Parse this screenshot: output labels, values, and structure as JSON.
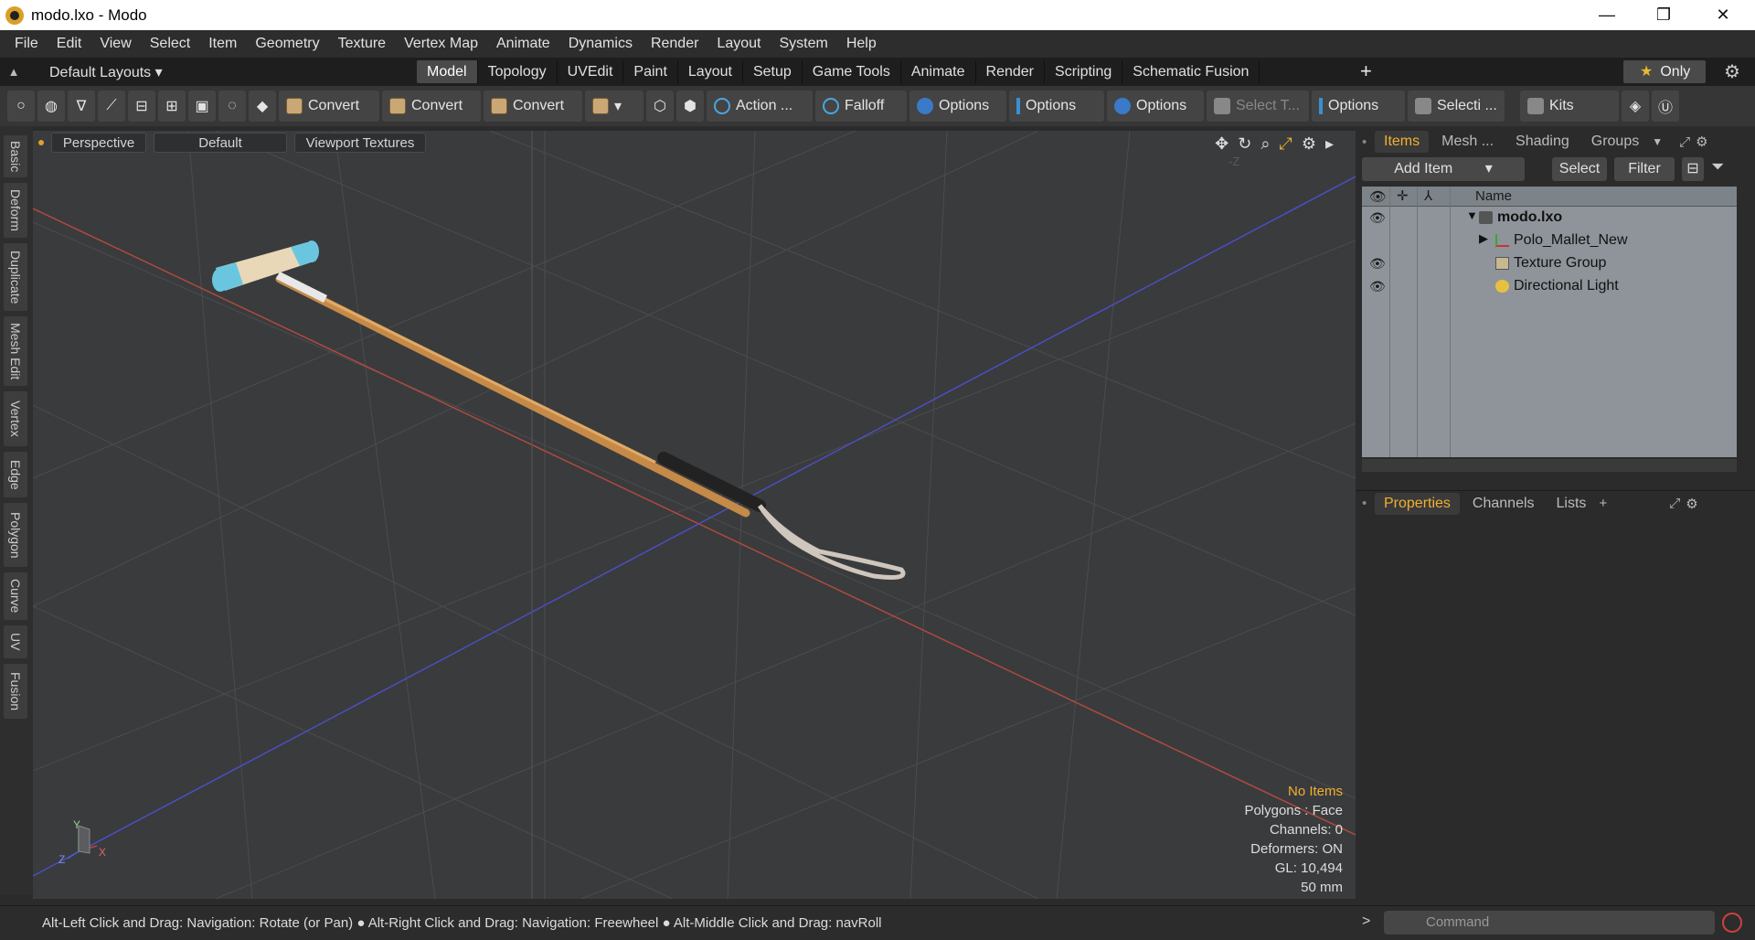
{
  "window": {
    "title": "modo.lxo - Modo",
    "minimize": "—",
    "restore": "❐",
    "close": "✕"
  },
  "menu": [
    "File",
    "Edit",
    "View",
    "Select",
    "Item",
    "Geometry",
    "Texture",
    "Vertex Map",
    "Animate",
    "Dynamics",
    "Render",
    "Layout",
    "System",
    "Help"
  ],
  "layouts": {
    "preset": "Default Layouts ▾",
    "tabs": [
      "Model",
      "Topology",
      "UVEdit",
      "Paint",
      "Layout",
      "Setup",
      "Game Tools",
      "Animate",
      "Render",
      "Scripting",
      "Schematic Fusion"
    ],
    "active_tab": "Model",
    "only": "Only"
  },
  "toolbar": {
    "convert1": "Convert",
    "convert2": "Convert",
    "convert3": "Convert",
    "action": "Action   ...",
    "falloff": "Falloff",
    "options1": "Options",
    "options2": "Options",
    "options3": "Options",
    "select_t": "Select T...",
    "options4": "Options",
    "selecti": "Selecti ...",
    "kits": "Kits"
  },
  "left_tabs": [
    "Basic",
    "Deform",
    "Duplicate",
    "Mesh Edit",
    "Vertex",
    "Edge",
    "Polygon",
    "Curve",
    "UV",
    "Fusion"
  ],
  "viewport": {
    "view": "Perspective",
    "shading": "Default",
    "textures": "Viewport Textures",
    "axis_label": "-Z",
    "info": {
      "no_items": "No Items",
      "polygons": "Polygons : Face",
      "channels": "Channels: 0",
      "deformers": "Deformers: ON",
      "gl": "GL: 10,494",
      "scale": "50 mm"
    },
    "gizmo": {
      "x": "X",
      "y": "Y",
      "z": "Z"
    }
  },
  "items_panel": {
    "tabs": [
      "Items",
      "Mesh ...",
      "Shading",
      "Groups"
    ],
    "active": "Items",
    "add_item": "Add Item",
    "select": "Select",
    "filter": "Filter",
    "col_name": "Name",
    "rows": [
      {
        "name": "modo.lxo",
        "visible": true
      },
      {
        "name": "Polo_Mallet_New",
        "visible": false
      },
      {
        "name": "Texture Group",
        "visible": true
      },
      {
        "name": "Directional Light",
        "visible": true
      }
    ]
  },
  "props_panel": {
    "tabs": [
      "Properties",
      "Channels",
      "Lists"
    ],
    "active": "Properties"
  },
  "status": {
    "hint": "Alt-Left Click and Drag: Navigation: Rotate (or Pan) ● Alt-Right Click and Drag: Navigation: Freewheel ● Alt-Middle Click and Drag: navRoll",
    "command_placeholder": "Command"
  },
  "colors": {
    "accent": "#f0b030",
    "x_axis": "#c04a40",
    "z_axis": "#4050c8"
  }
}
